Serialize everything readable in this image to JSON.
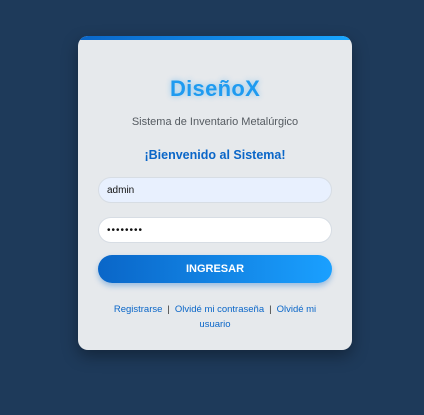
{
  "brand": "DiseñoX",
  "subtitle": "Sistema de Inventario Metalúrgico",
  "welcome": "¡Bienvenido al Sistema!",
  "form": {
    "username_value": "admin",
    "password_value": "••••••••",
    "submit_label": "INGRESAR"
  },
  "links": {
    "register": "Registrarse",
    "separator": "|",
    "forgot_password": "Olvidé mi contraseña",
    "forgot_user": "Olvidé mi usuario"
  },
  "colors": {
    "background": "#1e3a5a",
    "card": "#e6e9ec",
    "accent": "#0a66c8",
    "brand": "#1f9bf0"
  }
}
